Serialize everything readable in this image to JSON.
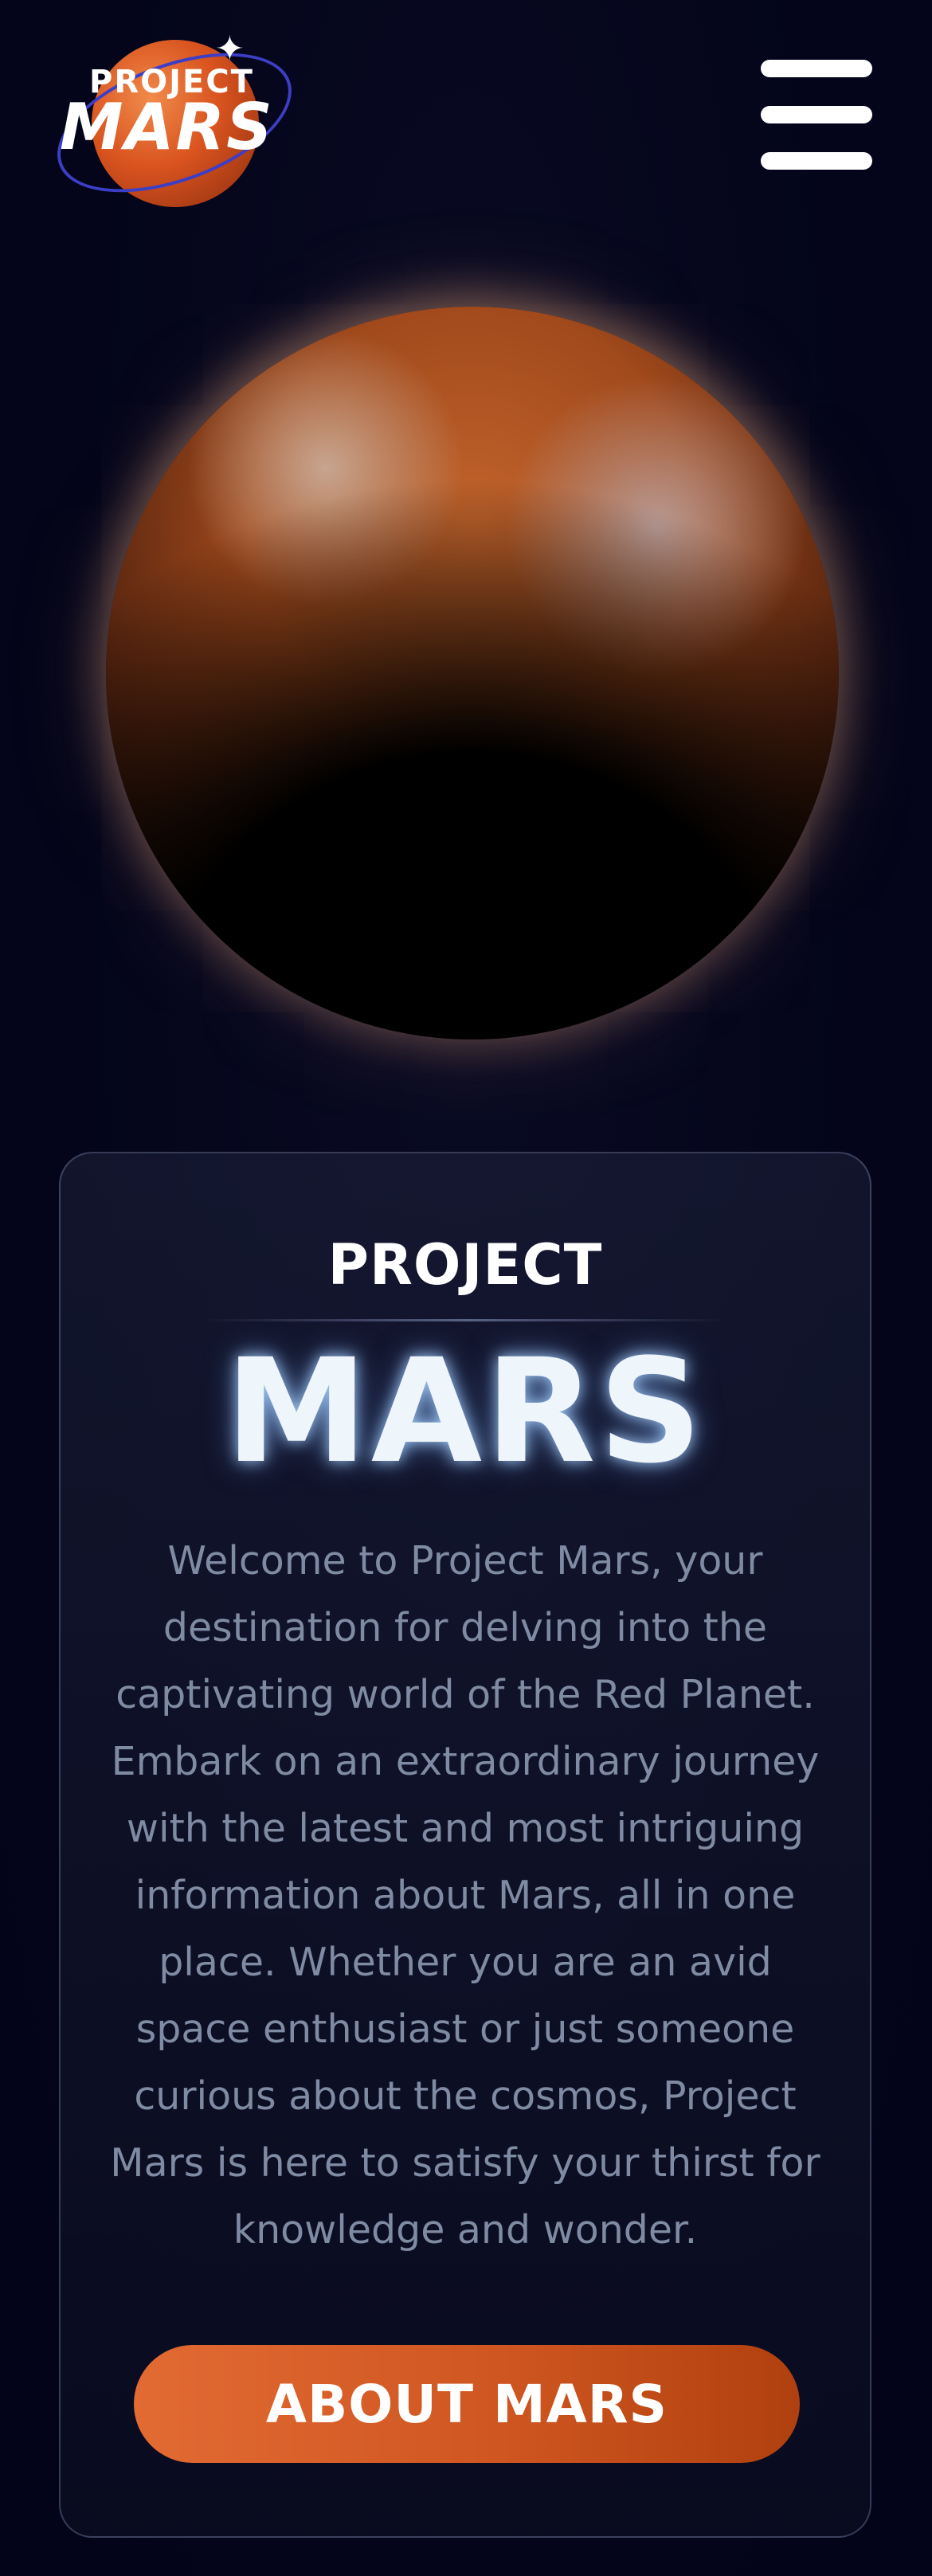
{
  "header": {
    "logo": {
      "text_top": "PROJECT",
      "text_main": "MARS"
    },
    "menu_icon": "hamburger-menu-icon"
  },
  "hero": {
    "image": "mars-planet-image"
  },
  "card": {
    "subtitle": "PROJECT",
    "title": "MARS",
    "description": "Welcome to Project Mars, your destination for delving into the captivating world of the Red Planet. Embark on an extraordinary journey with the latest and most intriguing information about Mars, all in one place. Whether you are an avid space enthusiast or just someone curious about the cosmos, Project Mars is here to satisfy your thirst for knowledge and wonder.",
    "button_label": "ABOUT MARS"
  },
  "colors": {
    "background": "#04051a",
    "accent": "#d9531f",
    "text_muted": "#7f8aa3",
    "title_glow": "#aad2ff"
  }
}
